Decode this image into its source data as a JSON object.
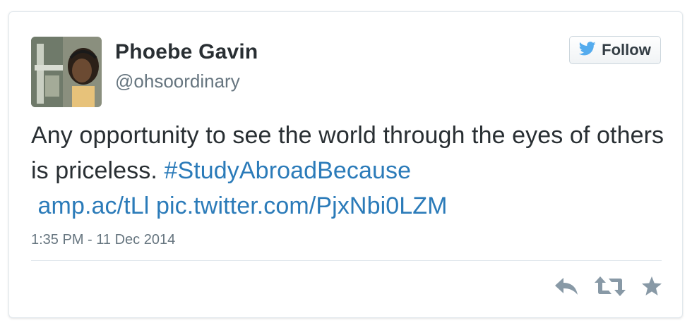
{
  "user": {
    "name": "Phoebe Gavin",
    "handle": "@ohsoordinary",
    "avatar_icon": "user-avatar-photo"
  },
  "follow_button": {
    "label": "Follow",
    "icon": "twitter-bird-icon"
  },
  "tweet": {
    "text_part1": "Any opportunity to see the world through the eyes of others is priceless.",
    "hashtag": "#StudyAbroadBecause",
    "link_short": "amp.ac/tLl",
    "link_pic": "pic.twitter.com/PjxNbi0LZM",
    "timestamp": "1:35 PM - 11 Dec 2014"
  },
  "actions": [
    {
      "name": "reply",
      "icon": "reply-icon"
    },
    {
      "name": "retweet",
      "icon": "retweet-icon"
    },
    {
      "name": "favorite",
      "icon": "star-icon"
    }
  ],
  "colors": {
    "link": "#2b7bb9",
    "text": "#292f33",
    "muted": "#66757f",
    "twitter_blue": "#55acee",
    "action_gray": "#8899a6"
  }
}
